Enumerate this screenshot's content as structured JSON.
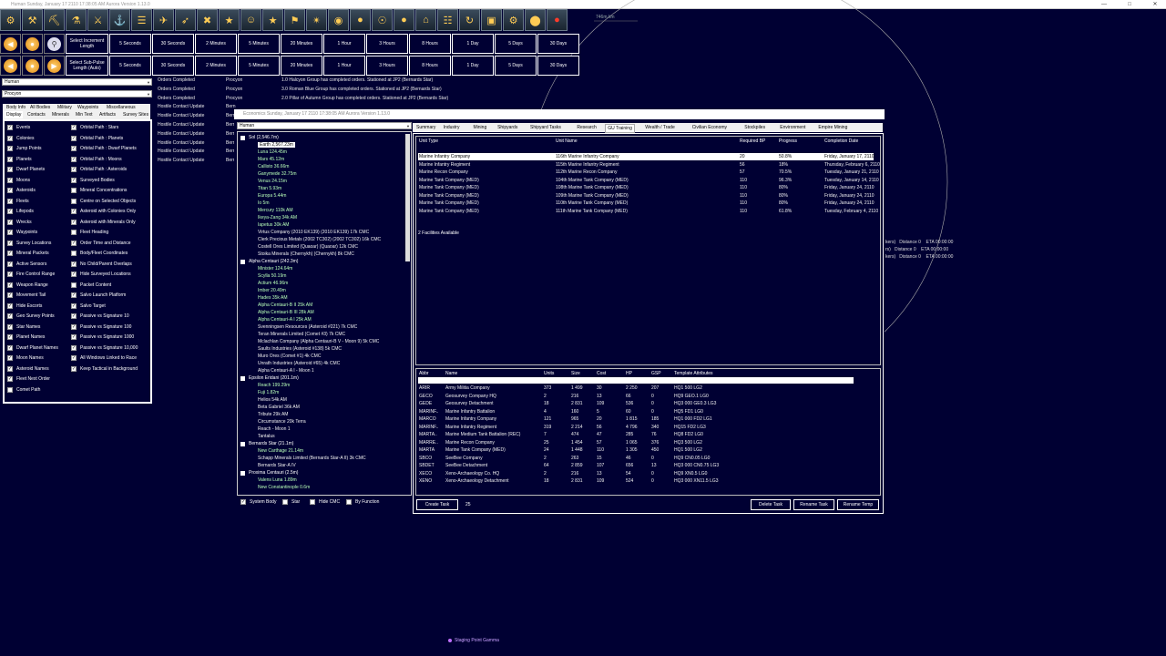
{
  "titlebar": {
    "text": "Human   Sunday, January 17 2110 17:38:05 AM   Aurora Version 1.13.0"
  },
  "map": {
    "scale_label": "746m km",
    "gamma_label": "Staging Point Gamma",
    "fleet_lines": [
      "kers)   Distance 0    ETA 00:00:00",
      "rs)   Distance 0    ETA 00:00:00",
      "kers)   Distance 0    ETA 00:00:00"
    ]
  },
  "toolbar_icons": [
    "colony-icon",
    "industry-icon",
    "mining-icon",
    "research-icon",
    "ground-icon",
    "ship-icon",
    "class-icon",
    "fleet-icon",
    "missile-icon",
    "gun-icon",
    "weapon-icon",
    "officer-icon",
    "medal-icon",
    "nation-icon",
    "galaxy-icon",
    "system-icon",
    "planet-icon",
    "turret-icon",
    "sphere-icon",
    "design-icon",
    "calendar-icon",
    "refresh-icon",
    "monitor-icon",
    "settings-icon",
    "bluefield-icon",
    "stop-icon"
  ],
  "time_rows": [
    {
      "label": "Select Increment Length",
      "buttons": [
        "5 Seconds",
        "30 Seconds",
        "2 Minutes",
        "5 Minutes",
        "20 Minutes",
        "1 Hour",
        "3 Hours",
        "8 Hours",
        "1 Day",
        "5 Days",
        "30 Days"
      ]
    },
    {
      "label": "Select Sub-Pulse Length (Auto)",
      "buttons": [
        "5 Seconds",
        "30 Seconds",
        "2 Minutes",
        "5 Minutes",
        "20 Minutes",
        "1 Hour",
        "3 Hours",
        "8 Hours",
        "1 Day",
        "5 Days",
        "30 Days"
      ]
    }
  ],
  "race_select": "Human",
  "system_select": "Procyon",
  "left_tabs_row1": [
    "Body Info",
    "All Bodies",
    "Military",
    "Waypoints",
    "Miscellaneous"
  ],
  "left_tabs_row2": [
    "Display",
    "Contacts",
    "Minerals",
    "Min Text",
    "Artifacts",
    "Survey Sites"
  ],
  "display_left": [
    {
      "label": "Events",
      "checked": true
    },
    {
      "label": "Colonies",
      "checked": true
    },
    {
      "label": "Jump Points",
      "checked": true
    },
    {
      "label": "Planets",
      "checked": true
    },
    {
      "label": "Dwarf Planets",
      "checked": true
    },
    {
      "label": "Moons",
      "checked": true
    },
    {
      "label": "Asteroids",
      "checked": true
    },
    {
      "label": "Fleets",
      "checked": true
    },
    {
      "label": "Lifepods",
      "checked": true
    },
    {
      "label": "Wrecks",
      "checked": true
    },
    {
      "label": "Waypoints",
      "checked": true
    },
    {
      "label": "Survey Locations",
      "checked": true
    },
    {
      "label": "Mineral Packets",
      "checked": true
    },
    {
      "label": "Active Sensors",
      "checked": true
    },
    {
      "label": "Fire Control Range",
      "checked": true
    },
    {
      "label": "Weapon Range",
      "checked": true
    },
    {
      "label": "Movement Tail",
      "checked": true
    },
    {
      "label": "Hide Escorts",
      "checked": true
    },
    {
      "label": "Geo Survey Points",
      "checked": true
    },
    {
      "label": "Star Names",
      "checked": true
    },
    {
      "label": "Planet Names",
      "checked": true
    },
    {
      "label": "Dwarf Planet Names",
      "checked": true
    },
    {
      "label": "Moon Names",
      "checked": true
    },
    {
      "label": "Asteroid Names",
      "checked": true
    },
    {
      "label": "Fleet Next Order",
      "checked": true
    },
    {
      "label": "Comet Path",
      "checked": false
    }
  ],
  "display_right": [
    {
      "label": "Orbital Path : Stars",
      "checked": true
    },
    {
      "label": "Orbital Path : Planets",
      "checked": true
    },
    {
      "label": "Orbital Path : Dwarf Planets",
      "checked": true
    },
    {
      "label": "Orbital Path : Moons",
      "checked": true
    },
    {
      "label": "Orbital Path : Asteroids",
      "checked": true
    },
    {
      "label": "Surveyed Bodies",
      "checked": true
    },
    {
      "label": "Mineral Concentrations",
      "checked": false
    },
    {
      "label": "Centre on Selected Objects",
      "checked": false
    },
    {
      "label": "Asteroid with Colonies Only",
      "checked": true
    },
    {
      "label": "Asteroid with Minerals Only",
      "checked": true
    },
    {
      "label": "Fleet Heading",
      "checked": false
    },
    {
      "label": "Order Time and Distance",
      "checked": true
    },
    {
      "label": "Body/Fleet Coordinates",
      "checked": false
    },
    {
      "label": "No Child/Parent Overlaps",
      "checked": true
    },
    {
      "label": "Hide Surveyed Locations",
      "checked": true
    },
    {
      "label": "Packet Content",
      "checked": false
    },
    {
      "label": "Salvo Launch Platform",
      "checked": true
    },
    {
      "label": "Salvo Target",
      "checked": true
    },
    {
      "label": "Passive vs Signature 10",
      "checked": true
    },
    {
      "label": "Passive vs Signature 100",
      "checked": true
    },
    {
      "label": "Passive vs Signature 1000",
      "checked": true
    },
    {
      "label": "Passive vs Signature 10,000",
      "checked": true
    },
    {
      "label": "All Windows Linked to Race",
      "checked": true
    },
    {
      "label": "Keep Tactical in Background",
      "checked": true
    }
  ],
  "events": [
    {
      "type": "Orders Completed",
      "loc": "Procyon",
      "text": "1.0 Halcyon Group has completed orders.  Stationed at JP2 (Bernards Star)"
    },
    {
      "type": "Orders Completed",
      "loc": "Procyon",
      "text": "3.0 Roman Blue Group has completed orders.  Stationed at JP2 (Bernards Star)"
    },
    {
      "type": "Orders Completed",
      "loc": "Procyon",
      "text": "2.0 Pillar of Autumn Group has completed orders.  Stationed at JP2 (Bernards Star)"
    },
    {
      "type": "Hostile Contact Update",
      "loc": "Bern",
      "text": ""
    },
    {
      "type": "Hostile Contact Update",
      "loc": "Bern",
      "text": ""
    },
    {
      "type": "Hostile Contact Update",
      "loc": "Bern",
      "text": ""
    },
    {
      "type": "Hostile Contact Update",
      "loc": "Bern",
      "text": ""
    },
    {
      "type": "Hostile Contact Update",
      "loc": "Bern",
      "text": ""
    },
    {
      "type": "Hostile Contact Update",
      "loc": "Bern",
      "text": ""
    },
    {
      "type": "Hostile Contact Update",
      "loc": "Bern",
      "text": ""
    }
  ],
  "economy": {
    "title": "Economics   Sunday, January 17 2110 17:38:05 AM   Aurora Version 1.13.0",
    "race_select": "Human",
    "tree": [
      {
        "t": "Sol  (2,546.7m)",
        "lvl": 0,
        "header": true
      },
      {
        "t": "Earth  2,567.23m",
        "lvl": 1,
        "selected": true
      },
      {
        "t": "Luna  124.45m",
        "lvl": 1
      },
      {
        "t": "Mars  45.12m",
        "lvl": 1
      },
      {
        "t": "Callisto  36.66m",
        "lvl": 1
      },
      {
        "t": "Ganymede  32.75m",
        "lvl": 1
      },
      {
        "t": "Venus  24.15m",
        "lvl": 1
      },
      {
        "t": "Titan  5.93m",
        "lvl": 1
      },
      {
        "t": "Europa  5.44m",
        "lvl": 1
      },
      {
        "t": "Io  5m",
        "lvl": 1
      },
      {
        "t": "Mercury  110k AM",
        "lvl": 1
      },
      {
        "t": "Ikeya-Zang  34k AM",
        "lvl": 1
      },
      {
        "t": "Iapetus  30k AM",
        "lvl": 1
      },
      {
        "t": "Virtus Company (2010 EK139) (2010 EK139)  17k CMC",
        "lvl": 1,
        "w": true
      },
      {
        "t": "Clerk Precious Metals (2002 TC302) (2002 TC302)  16k CMC",
        "lvl": 1,
        "w": true
      },
      {
        "t": "Costell Ores Limited (Quaoar) (Quaoar)  12k CMC",
        "lvl": 1,
        "w": true
      },
      {
        "t": "Stoika Minerals (Chernykh) (Chernykh)  8k CMC",
        "lvl": 1,
        "w": true
      },
      {
        "t": "Alpha Centauri  (242.3m)",
        "lvl": 0,
        "header": true
      },
      {
        "t": "Minister  124.64m",
        "lvl": 1
      },
      {
        "t": "Scylla  50.19m",
        "lvl": 1
      },
      {
        "t": "Actium  46.96m",
        "lvl": 1
      },
      {
        "t": "Imber  20.49m",
        "lvl": 1
      },
      {
        "t": "Hades  35k AM",
        "lvl": 1
      },
      {
        "t": "Alpha Centauri-B II  25k AM",
        "lvl": 1
      },
      {
        "t": "Alpha Centauri-B III  28k AM",
        "lvl": 1
      },
      {
        "t": "Alpha Centauri-A I  25k AM",
        "lvl": 1
      },
      {
        "t": "Svenningsen Resources (Asteroid #221)  7k CMC",
        "lvl": 1,
        "w": true
      },
      {
        "t": "Teran Minerals Limited (Comet #3)  7k CMC",
        "lvl": 1,
        "w": true
      },
      {
        "t": "Mclachlan Company (Alpha Centauri-B V - Moon 9)  5k CMC",
        "lvl": 1,
        "w": true
      },
      {
        "t": "Saults Industries (Asteroid #138)  5k CMC",
        "lvl": 1,
        "w": true
      },
      {
        "t": "Muro Ores (Comet #1)  4k CMC",
        "lvl": 1,
        "w": true
      },
      {
        "t": "Unrath Industries (Asteroid #65)  4k CMC",
        "lvl": 1,
        "w": true
      },
      {
        "t": "Alpha Centauri-A I - Moon 1",
        "lvl": 1,
        "w": true
      },
      {
        "t": "Epsilon Eridani  (201.1m)",
        "lvl": 0,
        "header": true
      },
      {
        "t": "Reach  199.29m",
        "lvl": 1
      },
      {
        "t": "Fuji  1.82m",
        "lvl": 1
      },
      {
        "t": "Helios  54k AM",
        "lvl": 1,
        "w": true
      },
      {
        "t": "Beta Gabriel  36k AM",
        "lvl": 1,
        "w": true
      },
      {
        "t": "Tribute  29k AM",
        "lvl": 1,
        "w": true
      },
      {
        "t": "Circumstance  20k Terra",
        "lvl": 1,
        "w": true
      },
      {
        "t": "Reach - Moon 1",
        "lvl": 1,
        "w": true
      },
      {
        "t": "Tantalus",
        "lvl": 1,
        "w": true
      },
      {
        "t": "Bernards Star  (21.1m)",
        "lvl": 0,
        "header": true
      },
      {
        "t": "New Carthage  21.14m",
        "lvl": 1
      },
      {
        "t": "Schapp Minerals Limited (Bernards Star-A II)  3k CMC",
        "lvl": 1,
        "w": true
      },
      {
        "t": "Bernards Star-A IV",
        "lvl": 1,
        "w": true
      },
      {
        "t": "Proxima Centauri  (2.5m)",
        "lvl": 0,
        "header": true
      },
      {
        "t": "Valens Luna  1.89m",
        "lvl": 1
      },
      {
        "t": "New Constantinople  0.6m",
        "lvl": 1
      }
    ],
    "tree_checks": [
      {
        "label": "System Body",
        "checked": true
      },
      {
        "label": "Star",
        "checked": false
      },
      {
        "label": "Hide CMC",
        "checked": false
      },
      {
        "label": "By Function",
        "checked": false
      }
    ],
    "tabs": [
      "Summary",
      "Industry",
      "Mining",
      "Shipyards",
      "Shipyard Tasks",
      "Research",
      "GU Training",
      "Wealth / Trade",
      "Civilian Economy",
      "Stockpiles",
      "Environment",
      "Empire Mining"
    ],
    "active_tab": "GU Training",
    "training_headers": [
      "Unit Type",
      "Unit Name",
      "Required BP",
      "Progress",
      "Completion Date"
    ],
    "training_rows": [
      [
        "Marine Infantry Company",
        "116th Marine Infantry Company",
        "20",
        "50.8%",
        "Friday, January 17, 2110"
      ],
      [
        "Marine Infantry Regiment",
        "115th Marine Infantry Regiment",
        "56",
        "18%",
        "Thursday, February 6, 2110"
      ],
      [
        "Marine Recon Company",
        "112th Marine Recon Company",
        "57",
        "70.5%",
        "Tuesday, January 21, 2110"
      ],
      [
        "Marine Tank Company (MED)",
        "104th Marine Tank Company (MED)",
        "110",
        "96.3%",
        "Tuesday, January 14, 2110"
      ],
      [
        "Marine Tank Company (MED)",
        "108th Marine Tank Company (MED)",
        "110",
        "80%",
        "Friday, January 24, 2110"
      ],
      [
        "Marine Tank Company (MED)",
        "109th Marine Tank Company (MED)",
        "110",
        "80%",
        "Friday, January 24, 2110"
      ],
      [
        "Marine Tank Company (MED)",
        "110th Marine Tank Company (MED)",
        "110",
        "80%",
        "Friday, January 24, 2110"
      ],
      [
        "Marine Tank Company (MED)",
        "111th Marine Tank Company (MED)",
        "110",
        "61.8%",
        "Tuesday, February 4, 2110"
      ]
    ],
    "facilities": "2 Facilities Available",
    "template_headers": [
      "Abbr",
      "Name",
      "Units",
      "Size",
      "Cost",
      "HP",
      "GSP",
      "Template Attributes"
    ],
    "template_rows": [
      [
        "ARIR",
        "Army Militia Company",
        "373",
        "1 499",
        "30",
        "2 250",
        "207",
        "HQ1 500  LG2"
      ],
      [
        "GECO",
        "Geosurvey Company HQ",
        "2",
        "216",
        "13",
        "66",
        "0",
        "HQ9  GEO.1  LG0"
      ],
      [
        "GEDE",
        "Geosurvey Detachment",
        "18",
        "2 831",
        "109",
        "536",
        "0",
        "HQ3 000  GE0.3  LG3"
      ],
      [
        "MARINF..",
        "Marine Infantry Battalion",
        "4",
        "160",
        "5",
        "60",
        "0",
        "HQ5  FD1  LG0"
      ],
      [
        "MARCO",
        "Marine Infantry Company",
        "121",
        "965",
        "20",
        "1 815",
        "185",
        "HQ1 000  FD2  LG1"
      ],
      [
        "MARINF..",
        "Marine Infantry Regiment",
        "319",
        "2 214",
        "56",
        "4 796",
        "340",
        "HQ15  FD2  LG3"
      ],
      [
        "MARTA..",
        "Marine Medium Tank Battalion (REC)",
        "7",
        "474",
        "47",
        "285",
        "76",
        "HQ8  FD2  LG0"
      ],
      [
        "MARRE..",
        "Marine Recon Company",
        "25",
        "1 454",
        "57",
        "1 065",
        "376",
        "HQ3 500  LG2"
      ],
      [
        "MARTA",
        "Marine Tank Company (MED)",
        "24",
        "1 448",
        "110",
        "1 305",
        "450",
        "HQ1 500  LG2"
      ],
      [
        "SBCO",
        "SeeBee Company",
        "2",
        "263",
        "15",
        "46",
        "0",
        "HQ9  CN0.05  LG0"
      ],
      [
        "SBDET",
        "SeeBee Detachment",
        "64",
        "2 859",
        "107",
        "656",
        "13",
        "HQ3 000  CN0.75  LG3"
      ],
      [
        "XECO",
        "Xeno-Archaeology Co. HQ",
        "2",
        "216",
        "13",
        "54",
        "0",
        "HQ9  XN0.5  LG0"
      ],
      [
        "XENO",
        "Xeno-Archaeology Detachment",
        "18",
        "2 831",
        "109",
        "524",
        "0",
        "HQ3 000  XN11.5  LG3"
      ]
    ],
    "create_task": "Create Task",
    "task_qty": "25",
    "delete_task": "Delete Task",
    "rename_task": "Rename Task",
    "rename_temp": "Rename Temp"
  }
}
